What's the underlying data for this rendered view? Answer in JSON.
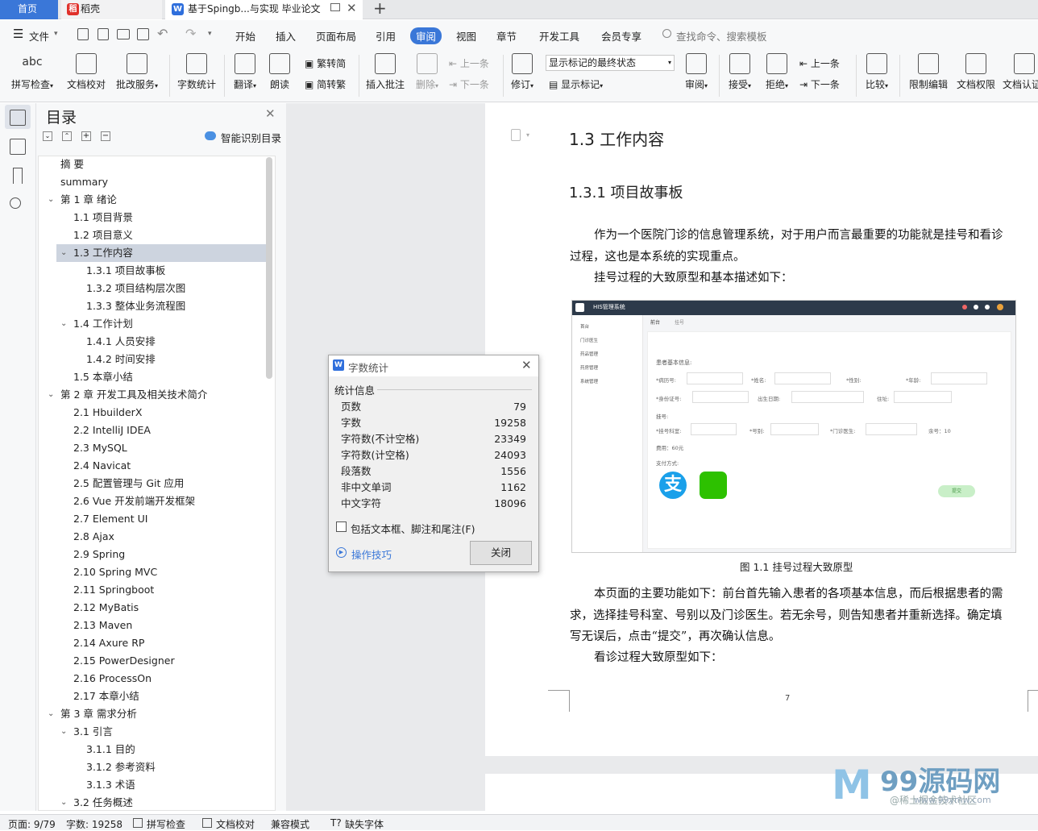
{
  "tabs": {
    "home": "首页",
    "daoke": "稻壳",
    "doc": "基于Spingb...与实现 毕业论文"
  },
  "menubar": {
    "file": "文件",
    "items": [
      "开始",
      "插入",
      "页面布局",
      "引用",
      "审阅",
      "视图",
      "章节",
      "开发工具",
      "会员专享"
    ],
    "search": "查找命令、搜索模板"
  },
  "ribbon": {
    "spell": "拼写检查",
    "proof": "文档校对",
    "annotate": "批改服务",
    "wordcount": "字数统计",
    "translate": "翻译",
    "read": "朗读",
    "trad": "繁转简",
    "simp": "简转繁",
    "insert_comment": "插入批注",
    "delete": "删除",
    "prev_comment": "上一条",
    "next_comment": "下一条",
    "revise": "修订",
    "markup_state": "显示标记的最终状态",
    "show_markup": "显示标记",
    "review": "审阅",
    "accept": "接受",
    "reject": "拒绝",
    "prev": "上一条",
    "next": "下一条",
    "compare": "比较",
    "restrict": "限制编辑",
    "permission": "文档权限",
    "doc_auth": "文档认证"
  },
  "toc": {
    "title": "目录",
    "smart": "智能识别目录",
    "items": [
      "摘 要",
      "summary",
      "第 1 章    绪论",
      "1.1  项目背景",
      "1.2  项目意义",
      "1.3  工作内容",
      "1.3.1  项目故事板",
      "1.3.2  项目结构层次图",
      "1.3.3  整体业务流程图",
      "1.4  工作计划",
      "1.4.1  人员安排",
      "1.4.2  时间安排",
      "1.5  本章小结",
      "第 2 章    开发工具及相关技术简介",
      "2.1 HbuilderX",
      "2.2 IntelliJ IDEA",
      "2.3 MySQL",
      "2.4 Navicat",
      "2.5  配置管理与 Git 应用",
      "2.6 Vue 开发前端开发框架",
      "2.7 Element UI",
      "2.8 Ajax",
      "2.9 Spring",
      "2.10 Spring MVC",
      "2.11 Springboot",
      "2.12 MyBatis",
      "2.13 Maven",
      "2.14 Axure RP",
      "2.15 PowerDesigner",
      "2.16 ProcessOn",
      "2.17  本章小结",
      "第 3 章  需求分析",
      "3.1 引言",
      "3.1.1 目的",
      "3.1.2 参考资料",
      "3.1.3 术语",
      "3.2 任务概述"
    ]
  },
  "dialog": {
    "title": "字数统计",
    "section": "统计信息",
    "rows": [
      {
        "k": "页数",
        "v": "79"
      },
      {
        "k": "字数",
        "v": "19258"
      },
      {
        "k": "字符数(不计空格)",
        "v": "23349"
      },
      {
        "k": "字符数(计空格)",
        "v": "24093"
      },
      {
        "k": "段落数",
        "v": "1556"
      },
      {
        "k": "非中文单词",
        "v": "1162"
      },
      {
        "k": "中文字符",
        "v": "18096"
      }
    ],
    "checkbox": "包括文本框、脚注和尾注(F)",
    "tips": "操作技巧",
    "close": "关闭"
  },
  "doc": {
    "h2": "1.3  工作内容",
    "h3": "1.3.1  项目故事板",
    "p1a": "作为一个医院门诊的信息管理系统，对于用户而言最重要的功能就是挂号和看诊",
    "p1b": "过程，这也是本系统的实现重点。",
    "p2": "挂号过程的大致原型和基本描述如下：",
    "caption": "图 1.1  挂号过程大致原型",
    "p3a": "本页面的主要功能如下：前台首先输入患者的各项基本信息，而后根据患者的需",
    "p3b": "求，选择挂号科室、号别以及门诊医生。若无余号，则告知患者并重新选择。确定填",
    "p3c": "写无误后，点击“提交”，再次确认信息。",
    "p4": "看诊过程大致原型如下：",
    "page_no": "7",
    "fig": {
      "app": "HIS管理系统",
      "tab1": "前台",
      "tab2": "挂号",
      "section": "患者基本信息:",
      "f1": "*病历号:",
      "f2": "*姓名:",
      "f3": "*性别:",
      "f4": "*年龄:",
      "f5": "*身份证号:",
      "f6": "出生日期:",
      "f7": "住址:",
      "reg": "挂号:",
      "f8": "*挂号科室:",
      "f9": "*号别:",
      "f10": "*门诊医生:",
      "remain": "余号：10",
      "fee": "费用：60元",
      "pay": "支付方式:",
      "submit": "提交",
      "nav": [
        "首台",
        "门诊医生",
        "药品管理",
        "药房管理",
        "系统管理"
      ]
    }
  },
  "status": {
    "page": "页面: 9/79",
    "words": "字数: 19258",
    "spell": "拼写检查",
    "proof": "文档校对",
    "compat": "兼容模式",
    "font": "缺失字体"
  },
  "watermark": {
    "logo": "99源码网",
    "sub": "@稀土掘金技术社区",
    "url": "www.99ymw.com"
  }
}
